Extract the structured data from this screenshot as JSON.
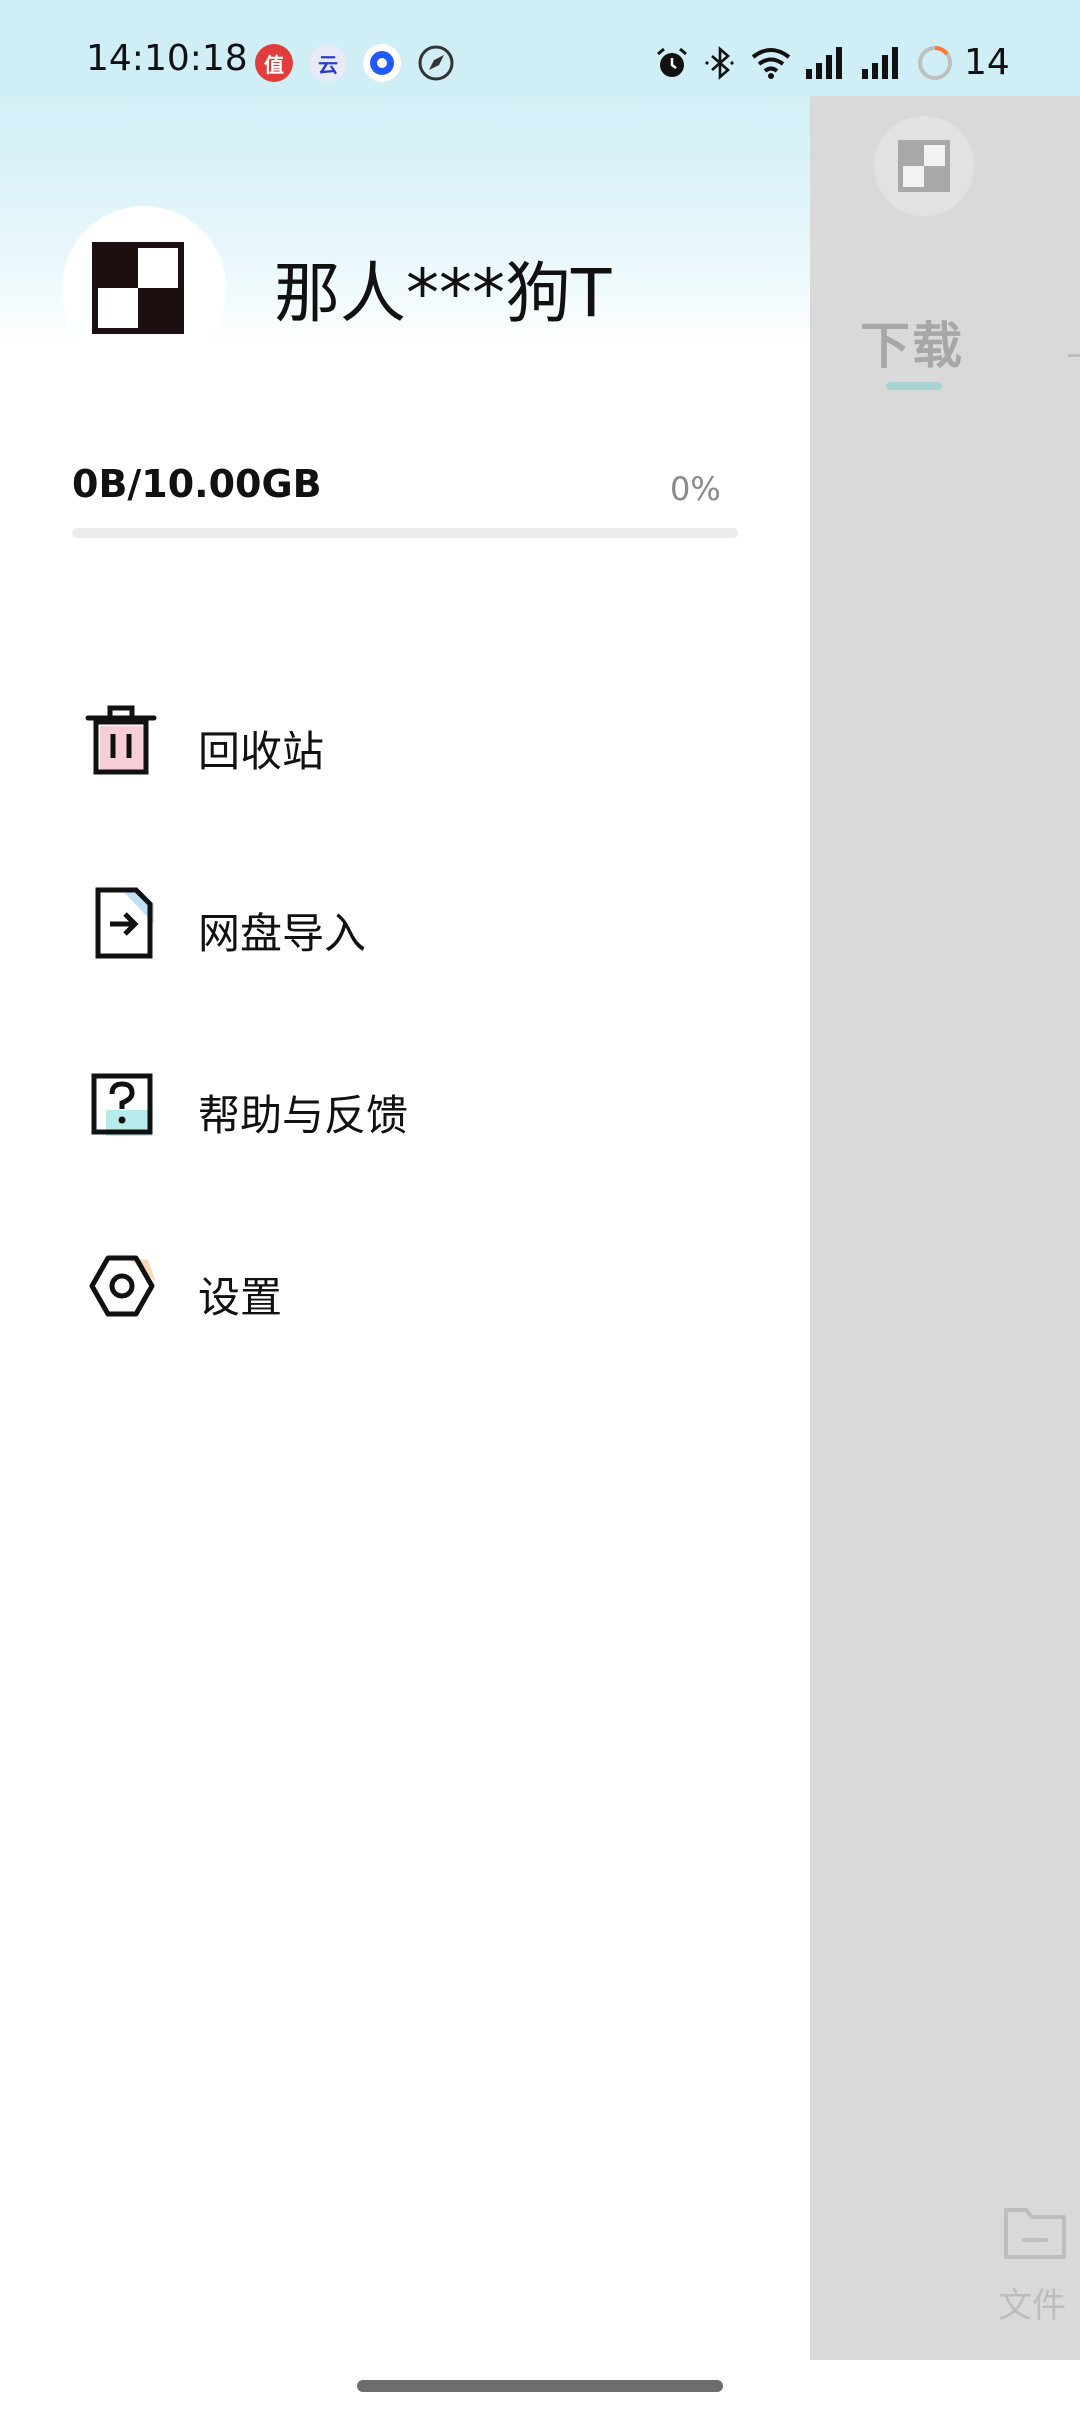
{
  "status_bar": {
    "time": "14:10:18",
    "battery": "14",
    "notification_icons": [
      {
        "name": "zhide-app-icon",
        "glyph": "值",
        "color": "#e33c3c"
      },
      {
        "name": "cloud-ai-app-icon",
        "glyph": "云",
        "color": "#e8eaf6"
      },
      {
        "name": "blue-dot-app-icon",
        "glyph": "",
        "color": "#1f5bff"
      },
      {
        "name": "compass-app-icon",
        "glyph": "",
        "color": "#333333"
      }
    ]
  },
  "profile": {
    "username": "那人***狗T"
  },
  "storage": {
    "used_label": "0B/10.00GB",
    "percent_label": "0%",
    "percent_value": 0
  },
  "menu": {
    "items": [
      {
        "label": "回收站",
        "icon": "trash-icon",
        "accent": "#f5c9d3"
      },
      {
        "label": "网盘导入",
        "icon": "import-icon",
        "accent": "#bfe0f5"
      },
      {
        "label": "帮助与反馈",
        "icon": "help-icon",
        "accent": "#b8ecec"
      },
      {
        "label": "设置",
        "icon": "settings-icon",
        "accent": "#fbd9b8"
      }
    ]
  },
  "background_app": {
    "tab_label": "下载",
    "files_label": "文件"
  },
  "colors": {
    "accent": "#5ac4c8",
    "header_gradient": "#cdeef6",
    "scrim": "#d9d9d9"
  }
}
